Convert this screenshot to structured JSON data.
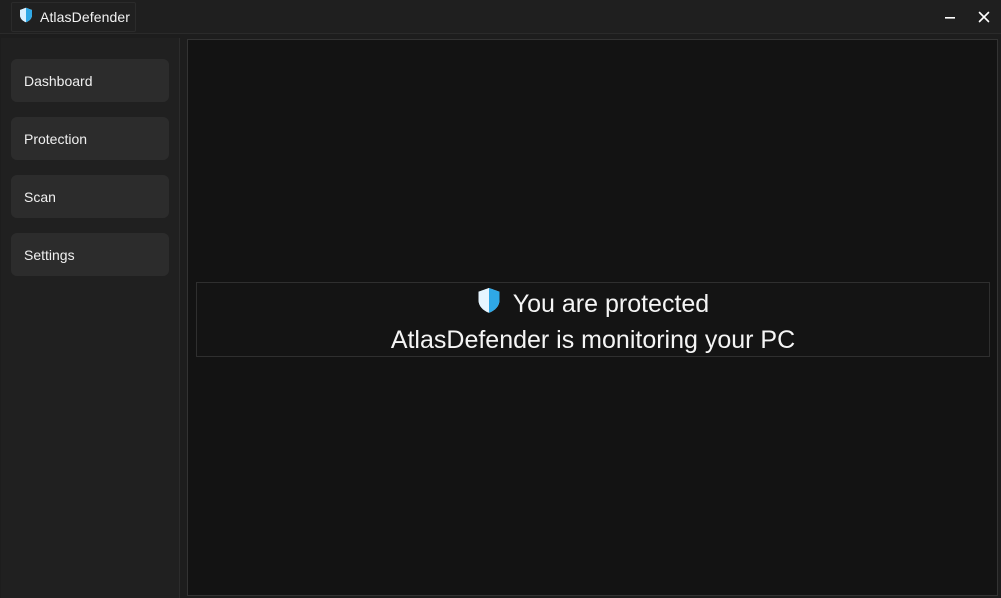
{
  "app": {
    "title": "AtlasDefender",
    "icon": "shield-icon",
    "accent_color": "#2fa8e6"
  },
  "window_controls": {
    "minimize_icon": "minimize-icon",
    "close_icon": "close-icon"
  },
  "sidebar": {
    "items": [
      {
        "label": "Dashboard"
      },
      {
        "label": "Protection"
      },
      {
        "label": "Scan"
      },
      {
        "label": "Settings"
      }
    ]
  },
  "status": {
    "icon": "shield-icon",
    "headline": "You are protected",
    "subtext": "AtlasDefender is monitoring your PC"
  }
}
